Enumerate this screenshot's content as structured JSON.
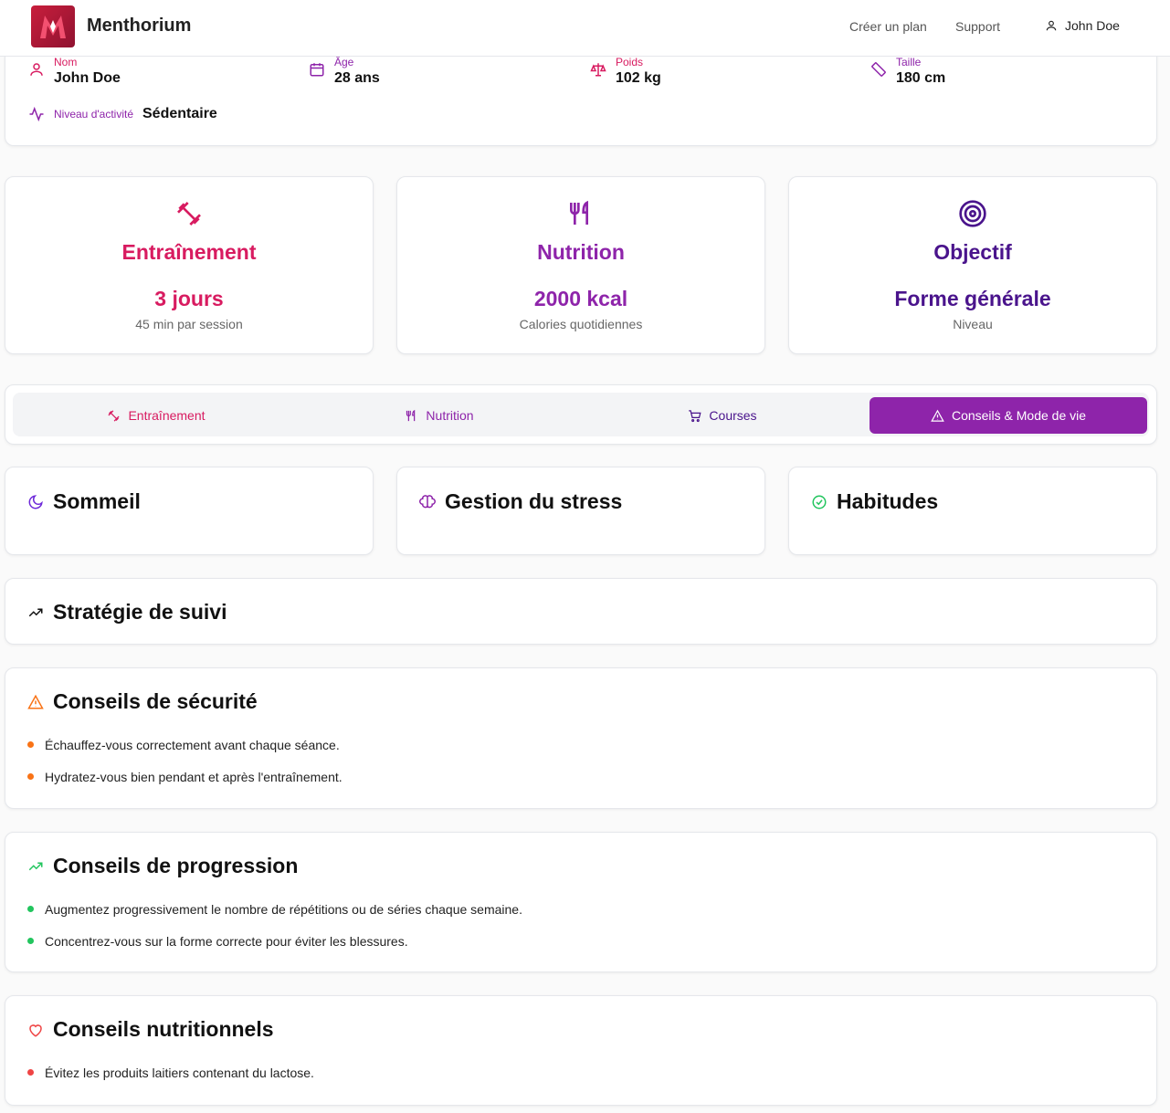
{
  "header": {
    "brand": "Menthorium",
    "nav": [
      "Créer un plan",
      "Support"
    ],
    "user": "John Doe"
  },
  "profile": {
    "name_label": "Nom",
    "name": "John Doe",
    "age_label": "Âge",
    "age": "28 ans",
    "weight_label": "Poids",
    "weight": "102 kg",
    "height_label": "Taille",
    "height": "180 cm",
    "activity_label": "Niveau d'activité",
    "activity": "Sédentaire"
  },
  "stats": [
    {
      "title": "Entraînement",
      "value": "3 jours",
      "sub": "45 min par session",
      "color": "#d81b60"
    },
    {
      "title": "Nutrition",
      "value": "2000 kcal",
      "sub": "Calories quotidiennes",
      "color": "#8e24aa"
    },
    {
      "title": "Objectif",
      "value": "Forme générale",
      "sub": "Niveau",
      "color": "#4a148c"
    }
  ],
  "tabs": [
    {
      "label": "Entraînement",
      "icon": "dumbbell-icon"
    },
    {
      "label": "Nutrition",
      "icon": "utensils-icon"
    },
    {
      "label": "Courses",
      "icon": "cart-icon"
    },
    {
      "label": "Conseils & Mode de vie",
      "icon": "warning-icon",
      "active": true
    }
  ],
  "sections": {
    "sleep": "Sommeil",
    "stress": "Gestion du stress",
    "habits": "Habitudes",
    "tracking": "Stratégie de suivi",
    "safety": {
      "title": "Conseils de sécurité",
      "items": [
        "Échauffez-vous correctement avant chaque séance.",
        "Hydratez-vous bien pendant et après l'entraînement."
      ]
    },
    "progression": {
      "title": "Conseils de progression",
      "items": [
        "Augmentez progressivement le nombre de répétitions ou de séries chaque semaine.",
        "Concentrez-vous sur la forme correcte pour éviter les blessures."
      ]
    },
    "nutrition": {
      "title": "Conseils nutritionnels",
      "items": [
        "Évitez les produits laitiers contenant du lactose."
      ]
    }
  },
  "colors": {
    "pink": "#d81b60",
    "purple": "#8e24aa",
    "deep_purple": "#4a148c",
    "orange": "#f97316",
    "green": "#22c55e",
    "red": "#ef4444"
  }
}
